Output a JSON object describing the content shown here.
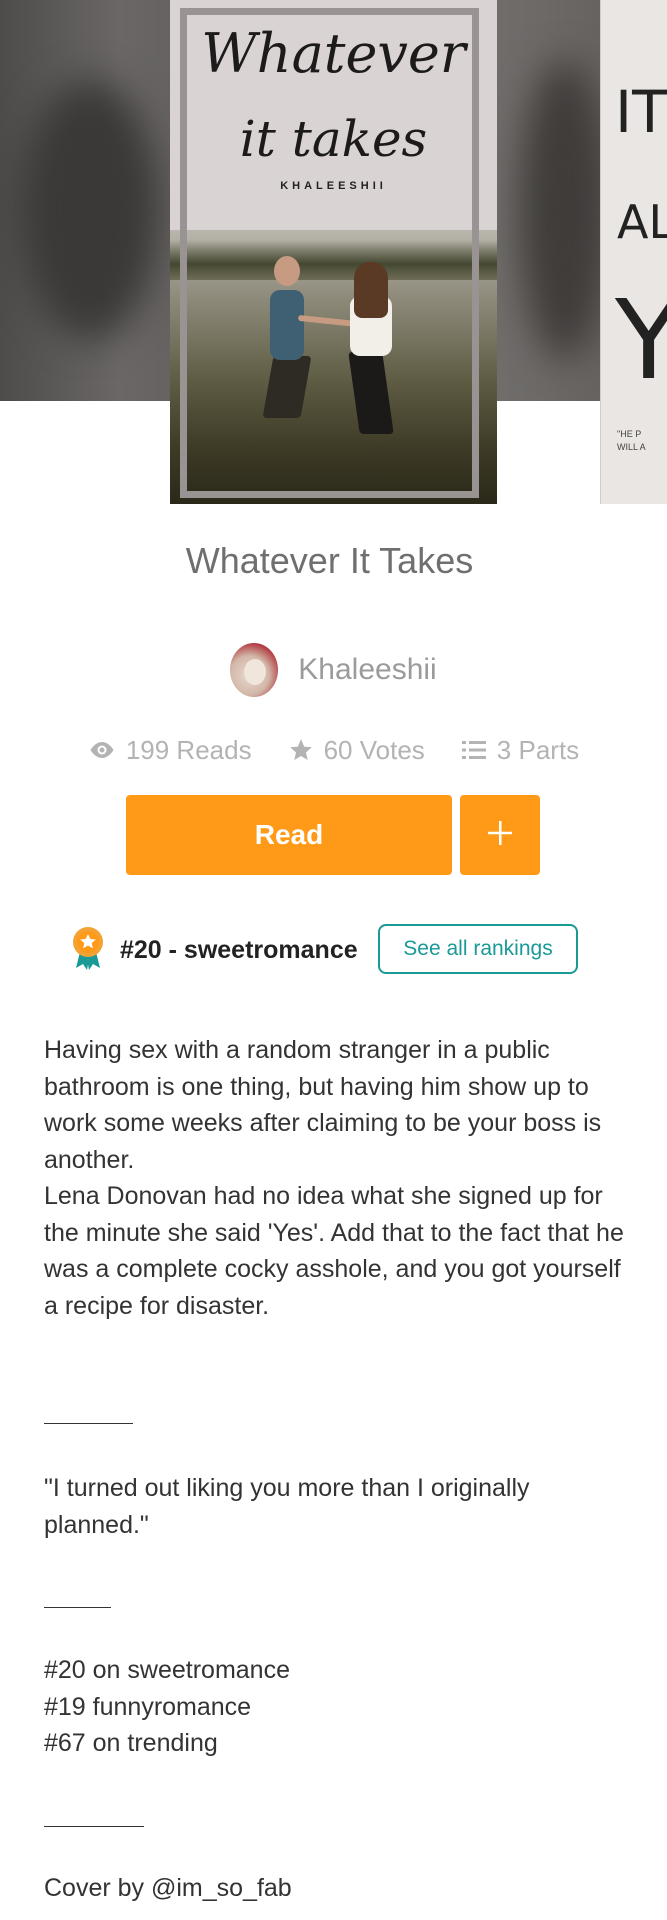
{
  "cover": {
    "title_line1": "Whatever",
    "title_line2": "it takes",
    "author": "KHALEESHII"
  },
  "next_cover": {
    "line1": "IT",
    "line2": "AL",
    "line3": "Y(",
    "line4": "\"HE P\nWILL A"
  },
  "story": {
    "title": "Whatever It Takes",
    "author": "Khaleeshii",
    "reads": "199 Reads",
    "votes": "60 Votes",
    "parts": "3 Parts",
    "read_label": "Read",
    "add_label": "+"
  },
  "ranking": {
    "text": "#20 - sweetromance",
    "button": "See all rankings"
  },
  "description": {
    "para1": "Having sex with a random stranger in a public bathroom is one thing, but having him show up to work some weeks after claiming to be your boss is another.",
    "para2": "Lena Donovan had no idea what she signed up for the minute she said 'Yes'. Add that to the fact that he was a complete cocky asshole, and you got yourself a recipe for disaster.",
    "quote": "\"I turned out liking you more than I originally planned.\"",
    "rank1": "#20 on sweetromance",
    "rank2": "#19 funnyromance",
    "rank3": "#67 on trending",
    "credit": "Cover by @im_so_fab"
  },
  "colors": {
    "accent": "#ff9a18",
    "teal": "#1a9a96",
    "muted": "#b3b3b3"
  },
  "icons": [
    "eye-icon",
    "star-icon",
    "list-icon",
    "plus-icon",
    "award-medal-icon"
  ]
}
